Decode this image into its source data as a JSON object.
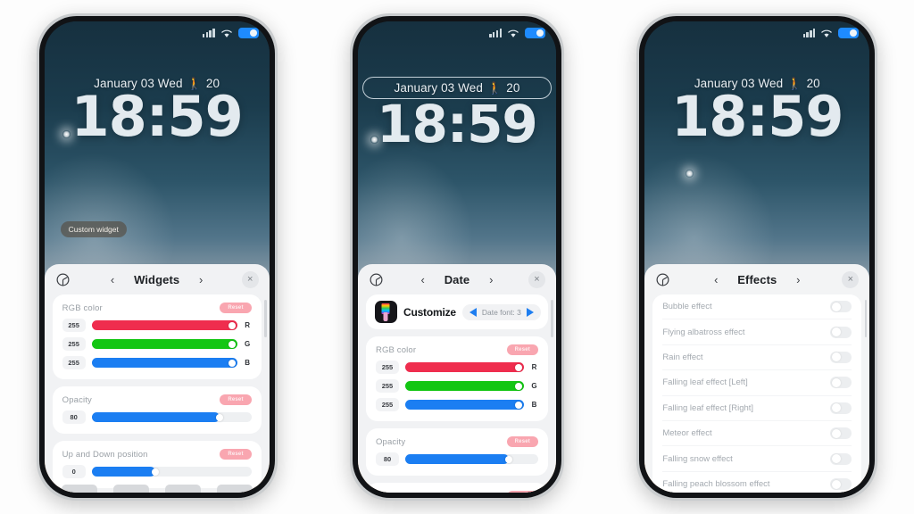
{
  "lockscreen": {
    "date_text": "January 03 Wed",
    "walk_icon": "walking-person-icon",
    "step_count": "20",
    "time": "18:59",
    "custom_widget_label": "Custom widget",
    "status": {
      "signal_icon": "signal-bars-icon",
      "wifi_icon": "wifi-icon",
      "battery_icon": "battery-icon"
    }
  },
  "phones": [
    {
      "id": "phone-widgets",
      "date_pill": false,
      "show_custom_widget": true,
      "panel": {
        "settings_icon": "clock-settings-icon",
        "prev_label": "‹",
        "title": "Widgets",
        "next_label": "›",
        "close_label": "×",
        "cards": [
          {
            "type": "sliders",
            "label": "RGB color",
            "reset_label": "Reset",
            "rows": [
              {
                "value": "255",
                "channel": "R",
                "percent": 100,
                "color": "#ef2d4e"
              },
              {
                "value": "255",
                "channel": "G",
                "percent": 100,
                "color": "#13c613"
              },
              {
                "value": "255",
                "channel": "B",
                "percent": 100,
                "color": "#1b7ef2"
              }
            ]
          },
          {
            "type": "sliders",
            "label": "Opacity",
            "reset_label": "Reset",
            "rows": [
              {
                "value": "80",
                "channel": "",
                "percent": 80,
                "color": "#1b7ef2"
              }
            ]
          },
          {
            "type": "sliders",
            "label": "Up and Down position",
            "reset_label": "Reset",
            "rows": [
              {
                "value": "0",
                "channel": "",
                "percent": 40,
                "color": "#1b7ef2"
              }
            ]
          }
        ]
      }
    },
    {
      "id": "phone-date",
      "date_pill": true,
      "show_custom_widget": false,
      "panel": {
        "settings_icon": "clock-settings-icon",
        "prev_label": "‹",
        "title": "Date",
        "next_label": "›",
        "close_label": "×",
        "customize": {
          "icon": "customize-paint-icon",
          "name": "Customize",
          "font_prev_icon": "triangle-left-icon",
          "font_label": "Date font: 3",
          "font_next_icon": "triangle-right-icon"
        },
        "cards": [
          {
            "type": "sliders",
            "label": "RGB color",
            "reset_label": "Reset",
            "rows": [
              {
                "value": "255",
                "channel": "R",
                "percent": 100,
                "color": "#ef2d4e"
              },
              {
                "value": "255",
                "channel": "G",
                "percent": 100,
                "color": "#13c613"
              },
              {
                "value": "255",
                "channel": "B",
                "percent": 100,
                "color": "#1b7ef2"
              }
            ]
          },
          {
            "type": "sliders",
            "label": "Opacity",
            "reset_label": "Reset",
            "rows": [
              {
                "value": "80",
                "channel": "",
                "percent": 78,
                "color": "#1b7ef2"
              }
            ]
          }
        ]
      }
    },
    {
      "id": "phone-effects",
      "date_pill": false,
      "show_custom_widget": false,
      "panel": {
        "settings_icon": "clock-settings-icon",
        "prev_label": "‹",
        "title": "Effects",
        "next_label": "›",
        "close_label": "×",
        "effects": [
          {
            "label": "Bubble effect",
            "on": false
          },
          {
            "label": "Flying albatross effect",
            "on": false
          },
          {
            "label": "Rain effect",
            "on": false
          },
          {
            "label": "Falling leaf effect [Left]",
            "on": false
          },
          {
            "label": "Falling leaf effect [Right]",
            "on": false
          },
          {
            "label": "Meteor effect",
            "on": false
          },
          {
            "label": "Falling snow effect",
            "on": false
          },
          {
            "label": "Falling peach blossom effect",
            "on": false
          }
        ]
      }
    }
  ],
  "colors": {
    "accent_blue": "#1b7ef2",
    "slider_red": "#ef2d4e",
    "slider_green": "#13c613",
    "reset_pink": "#f9a6b0",
    "panel_bg": "#f1f2f4",
    "card_bg": "#ffffff"
  }
}
